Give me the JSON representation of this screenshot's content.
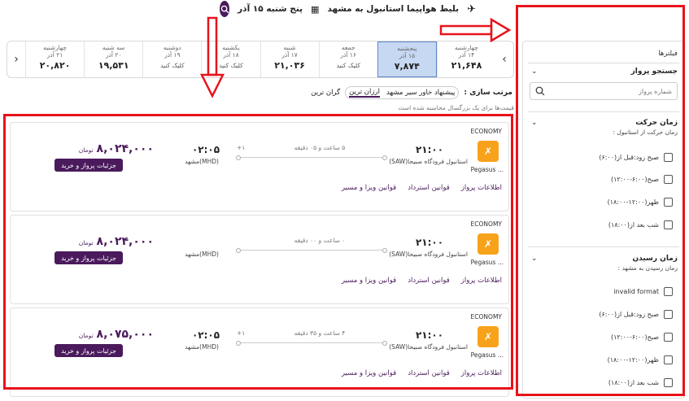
{
  "header": {
    "route": "بلیط هواپیما استانبول به مشهد",
    "date": "پنج شنبه ۱۵ آذر"
  },
  "date_strip": [
    {
      "day": "چهارشنبه",
      "date": "۱۴ آذر",
      "price": "۲۱,۶۴۸",
      "click": ""
    },
    {
      "day": "پنجشنبه",
      "date": "۱۵ آذر",
      "price": "۷,۸۷۴",
      "click": "",
      "active": true
    },
    {
      "day": "جمعه",
      "date": "۱۶ آذر",
      "price": "",
      "click": "کلیک کنید"
    },
    {
      "day": "شنبه",
      "date": "۱۷ آذر",
      "price": "۲۱,۰۳۶",
      "click": ""
    },
    {
      "day": "یکشنبه",
      "date": "۱۸ آذر",
      "price": "",
      "click": "کلیک کنید"
    },
    {
      "day": "دوشنبه",
      "date": "۱۹ آذر",
      "price": "",
      "click": "کلیک کنید"
    },
    {
      "day": "سه شنبه",
      "date": "۲۰ آذر",
      "price": "۱۹,۵۳۱",
      "click": ""
    },
    {
      "day": "چهارشنبه",
      "date": "۲۱ آذر",
      "price": "۲۰,۸۲۰",
      "click": ""
    }
  ],
  "sort": {
    "label": "مرتب سازی :",
    "options": [
      "پیشنهاد خاور سیر مشهد",
      "ارزان ترین",
      "گران ترین"
    ]
  },
  "notice": "قیمت‌ها برای یک بزرگسال محاسبه شده است",
  "flights": [
    {
      "cabin": "ECONOMY",
      "airline": "Pegasus ...",
      "dep_time": "۲۱:۰۰",
      "dep_airport": "استانبول فرودگاه صبیحا(SAW)",
      "duration": "۵ ساعت و ۰۵ دقیقه",
      "day_plus": "+۱",
      "arr_time": "۰۲:۰۵",
      "arr_airport": "مشهد(MHD)",
      "price": "۸,۰۲۴,۰۰۰",
      "currency": "تومان",
      "buy": "جزئیات پرواز و خرید",
      "links": [
        "اطلاعات پرواز",
        "قوانین استرداد",
        "قوانین ویزا و مسیر"
      ]
    },
    {
      "cabin": "ECONOMY",
      "airline": "Pegasus ...",
      "dep_time": "۲۱:۰۰",
      "dep_airport": "استانبول فرودگاه صبیحا(SAW)",
      "duration": "۰ ساعت و ۰۰ دقیقه",
      "day_plus": "",
      "arr_time": "",
      "arr_airport": "مشهد(MHD)",
      "price": "۸,۰۲۴,۰۰۰",
      "currency": "تومان",
      "buy": "جزئیات پرواز و خرید",
      "links": [
        "اطلاعات پرواز",
        "قوانین استرداد",
        "قوانین ویزا و مسیر"
      ]
    },
    {
      "cabin": "ECONOMY",
      "airline": "Pegasus ...",
      "dep_time": "۲۱:۰۰",
      "dep_airport": "استانبول فرودگاه صبیحا(SAW)",
      "duration": "۴ ساعت و ۳۵ دقیقه",
      "day_plus": "+۱",
      "arr_time": "۰۲:۰۵",
      "arr_airport": "مشهد(MHD)",
      "price": "۸,۰۷۵,۰۰۰",
      "currency": "تومان",
      "buy": "جزئیات پرواز و خرید",
      "links": [
        "اطلاعات پرواز",
        "قوانین استرداد",
        "قوانین ویزا و مسیر"
      ]
    }
  ],
  "sidebar": {
    "title": "فیلترها",
    "flight_search": {
      "heading": "جستجو پرواز",
      "placeholder": "شماره پرواز"
    },
    "departure": {
      "heading": "زمان حرکت",
      "sub": "زمان حرکت از استانبول :",
      "options": [
        "صبح زود:قبل از(۶:۰۰)",
        "صبح(۶:۰۰-۱۲:۰۰)",
        "ظهر(۱۲:۰۰-۱۸:۰۰)",
        "شب بعد از(۱۸:۰۰)"
      ]
    },
    "arrival": {
      "heading": "زمان رسیدن",
      "sub": "زمان رسیدن به مشهد :",
      "options": [
        "invalid format",
        "صبح زود:قبل از(۶:۰۰)",
        "صبح(۶:۰۰-۱۲:۰۰)",
        "ظهر(۱۲:۰۰-۱۸:۰۰)",
        "شب بعد از(۱۸:۰۰)"
      ]
    }
  },
  "colors": {
    "brand": "#4a1a5c",
    "annotation": "#e8131b",
    "active_day": "#c7d8f2",
    "logo": "#f7a21b"
  }
}
